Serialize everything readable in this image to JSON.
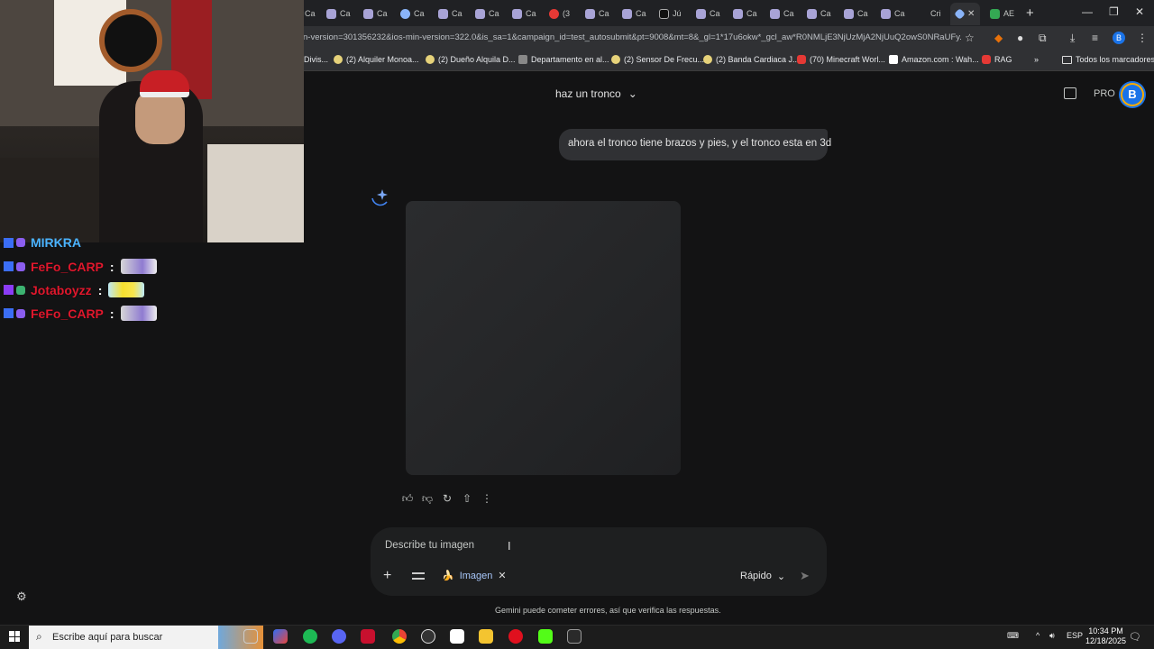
{
  "browser": {
    "tabs": [
      {
        "label": "Ca"
      },
      {
        "label": "Ca"
      },
      {
        "label": "Ca"
      },
      {
        "label": "Ca"
      },
      {
        "label": "Ca"
      },
      {
        "label": "Ca"
      },
      {
        "label": "Ca"
      },
      {
        "label": "Ca"
      },
      {
        "label": "(3"
      },
      {
        "label": "Ca"
      },
      {
        "label": "Ca"
      },
      {
        "label": "Jú"
      },
      {
        "label": "Ca"
      },
      {
        "label": "Ca"
      },
      {
        "label": "Ca"
      },
      {
        "label": "Ca"
      },
      {
        "label": "Ca"
      },
      {
        "label": "Ca"
      },
      {
        "label": "Cri"
      },
      {
        "label": "AE"
      }
    ],
    "new_tab": "+",
    "url": "n-version=301356232&ios-min-version=322.0&is_sa=1&campaign_id=test_autosubmit&pt=9008&mt=8&_gl=1*17u6okw*_gcl_aw*R0NMLjE3NjUzMjA2NjUuQ2owS0NRaUFy...",
    "profile_initial": "B",
    "bookmarks": [
      {
        "label": "Divis..."
      },
      {
        "label": "(2) Alquiler Monoa..."
      },
      {
        "label": "(2) Dueño Alquila D..."
      },
      {
        "label": "Departamento en al..."
      },
      {
        "label": "(2) Sensor De Frecu..."
      },
      {
        "label": "(2) Banda Cardiaca J..."
      },
      {
        "label": "(70) Minecraft Worl..."
      },
      {
        "label": "Amazon.com : Wah..."
      },
      {
        "label": "RAG"
      }
    ],
    "bookmarks_more": "»",
    "all_bookmarks": "Todos los marcadores"
  },
  "gemini": {
    "model_title": "haz un tronco",
    "pro_label": "PRO",
    "avatar_initial": "B",
    "user_message": "ahora el tronco tiene brazos y pies, y el tronco esta en 3d",
    "composer_placeholder": "Describe tu imagen",
    "chip_label": "Imagen",
    "chip_emoji": "🍌",
    "speed_label": "Rápido",
    "disclaimer": "Gemini puede cometer errores, así que verifica las respuestas."
  },
  "stream_chat": {
    "partial_user": "MIRKRA",
    "messages": [
      {
        "user": "FeFo_CARP",
        "colon": ":"
      },
      {
        "user": "Jotaboyzz",
        "colon": ":"
      },
      {
        "user": "FeFo_CARP",
        "colon": ":"
      }
    ]
  },
  "taskbar": {
    "search_placeholder": "Escribe aquí para buscar",
    "language": "ESP",
    "time": "10:34 PM",
    "date": "12/18/2025"
  }
}
